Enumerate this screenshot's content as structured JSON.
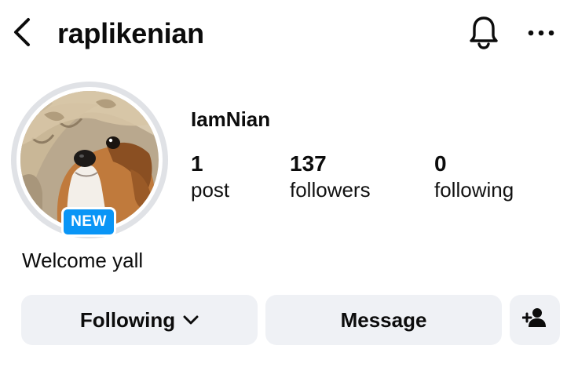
{
  "header": {
    "username": "raplikenian",
    "back_icon": "chevron-left-icon",
    "bell_icon": "bell-icon",
    "more_icon": "more-horizontal-icon"
  },
  "profile": {
    "display_name": "IamNian",
    "badge": "NEW",
    "bio": "Welcome yall"
  },
  "stats": [
    {
      "value": "1",
      "label": "post"
    },
    {
      "value": "137",
      "label": "followers"
    },
    {
      "value": "0",
      "label": "following"
    }
  ],
  "actions": {
    "following_label": "Following",
    "message_label": "Message",
    "add_user_icon": "add-person-icon"
  },
  "colors": {
    "badge": "#0995f6",
    "button_bg": "#eff1f5",
    "avatar_ring": "#e0e2e6"
  }
}
